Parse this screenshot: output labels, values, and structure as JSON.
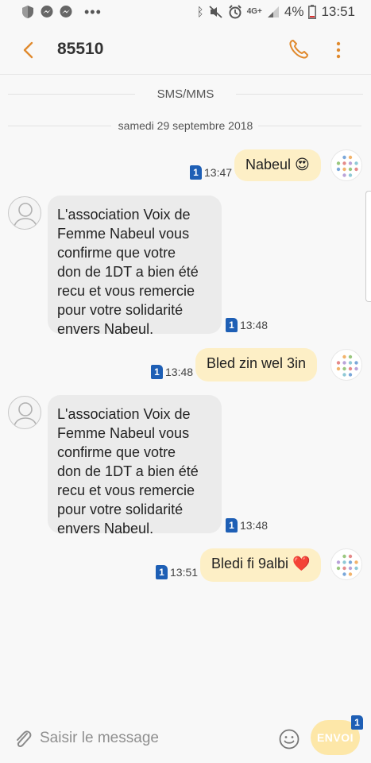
{
  "status_bar": {
    "battery": "4%",
    "network": "4G+",
    "time": "13:51",
    "icons": [
      "shield-icon",
      "messenger-icon",
      "messenger-icon",
      "more-dots-icon",
      "bluetooth-icon",
      "mute-icon",
      "alarm-icon",
      "signal-icon",
      "battery-icon"
    ]
  },
  "header": {
    "title": "85510",
    "icons": [
      "back-arrow-icon",
      "phone-icon",
      "more-vertical-icon"
    ],
    "accent_color": "#e08a2e"
  },
  "thread": {
    "type_label": "SMS/MMS",
    "date_label": "samedi 29 septembre 2018"
  },
  "messages": [
    {
      "direction": "outgoing",
      "text": "Nabeul 😍",
      "sim": "1",
      "time": "13:47"
    },
    {
      "direction": "incoming",
      "lines": [
        "L'association Voix de",
        "Femme Nabeul vous",
        "confirme que votre",
        "don de 1DT a bien été",
        "recu et vous remercie",
        "pour votre solidarité",
        "envers Nabeul."
      ],
      "sim": "1",
      "time": "13:48"
    },
    {
      "direction": "outgoing",
      "text": "Bled zin wel 3in",
      "sim": "1",
      "time": "13:48"
    },
    {
      "direction": "incoming",
      "lines": [
        "L'association Voix de",
        "Femme Nabeul vous",
        "confirme que votre",
        "don de 1DT a bien été",
        "recu et vous remercie",
        "pour votre solidarité",
        "envers Nabeul."
      ],
      "sim": "1",
      "time": "13:48"
    },
    {
      "direction": "outgoing",
      "text": "Bledi fi 9albi ❤️",
      "sim": "1",
      "time": "13:51"
    }
  ],
  "composer": {
    "placeholder": "Saisir le message",
    "send_label": "ENVOI",
    "sim": "1",
    "icons": [
      "paperclip-icon",
      "emoji-icon"
    ]
  },
  "colors": {
    "outgoing_bubble": "#fdefc6",
    "incoming_bubble": "#ebebeb",
    "sim_badge": "#1e5fb5",
    "send_button": "#fde7a8"
  }
}
